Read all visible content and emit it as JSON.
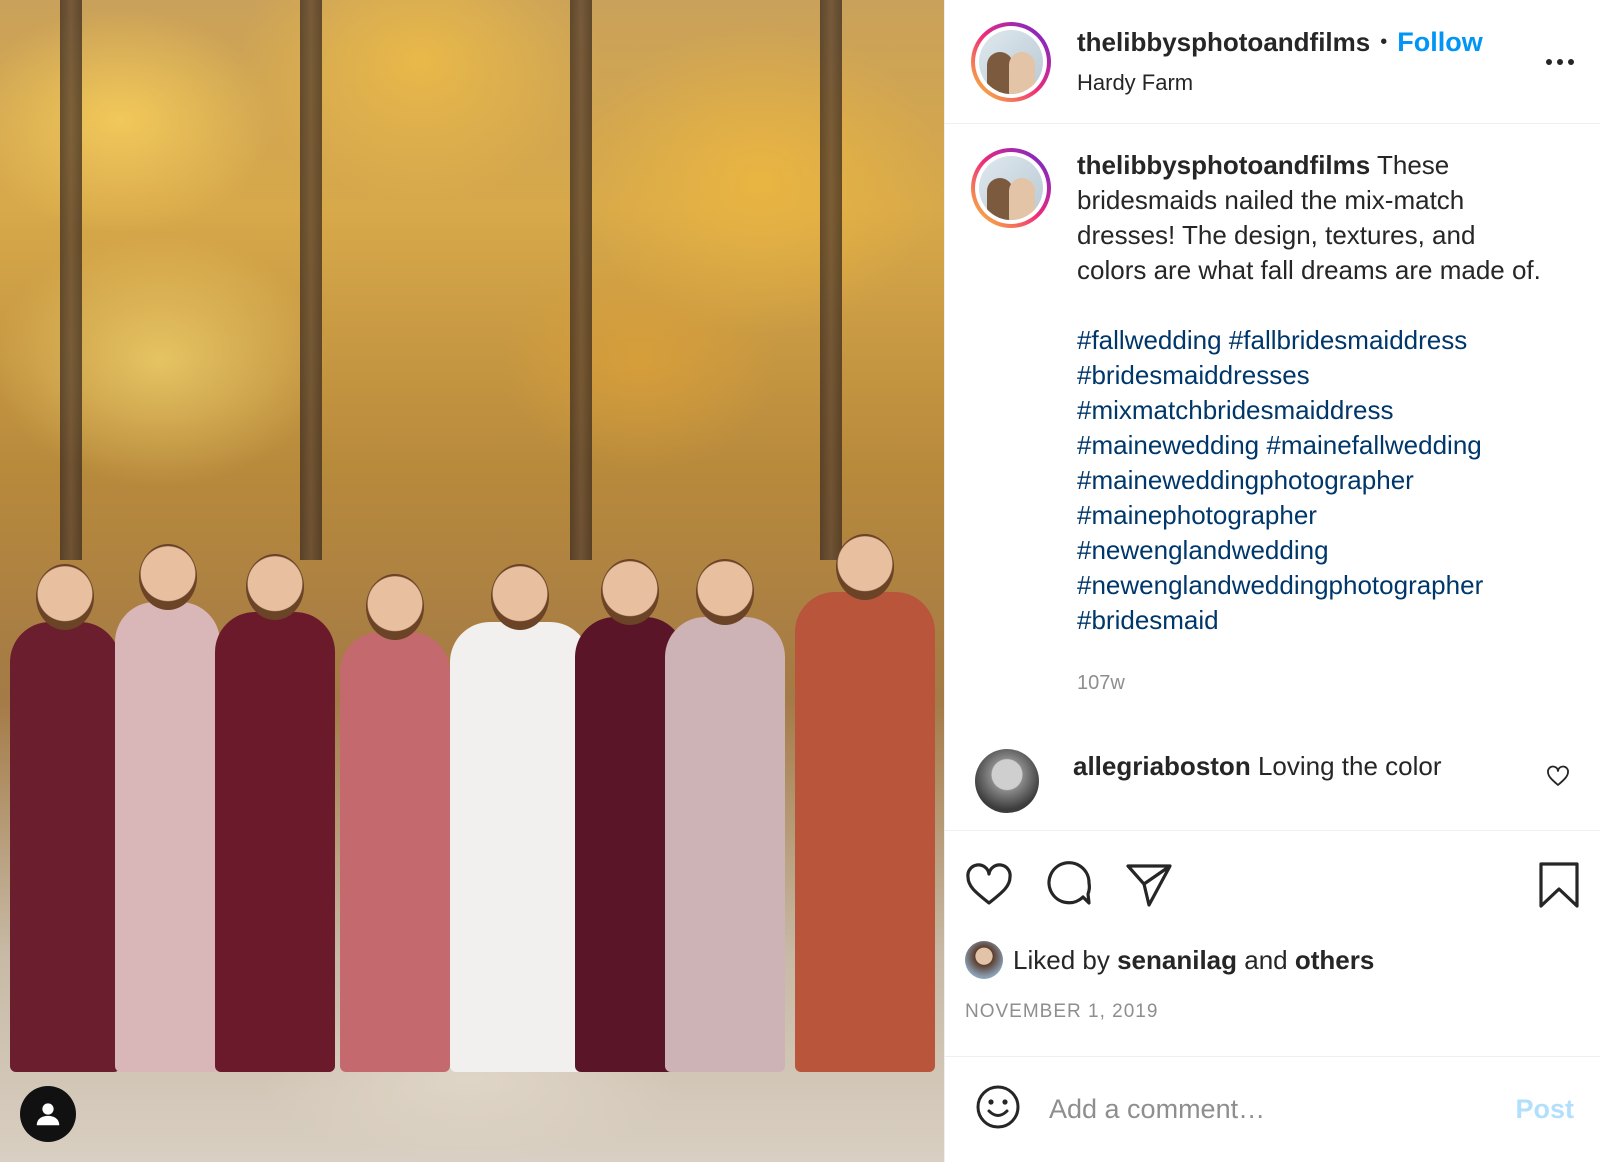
{
  "post": {
    "image": {
      "alt_icon": "person-circle-icon"
    },
    "header": {
      "username": "thelibbysphotoandfilms",
      "separator": "•",
      "follow_label": "Follow",
      "location": "Hardy Farm",
      "more_icon": "more-dots-icon"
    },
    "caption": {
      "username": "thelibbysphotoandfilms",
      "text": "These bridesmaids nailed the mix-match dresses! The design, textures, and colors are what fall dreams are made of.",
      "hashtags": [
        "#fallwedding",
        "#fallbridesmaiddress",
        "#bridesmaiddresses",
        "#mixmatchbridesmaiddress",
        "#mainewedding",
        "#mainefallwedding",
        "#maineweddingphotographer",
        "#mainephotographer",
        "#newenglandwedding",
        "#newenglandweddingphotographer",
        "#bridesmaid"
      ],
      "age": "107w"
    },
    "first_comment": {
      "username": "allegriaboston",
      "text": "Loving the color"
    },
    "likes": {
      "prefix": "Liked by",
      "user": "senanilag",
      "middle": "and",
      "others": "others"
    },
    "date": "November 1, 2019",
    "add_comment": {
      "placeholder": "Add a comment…",
      "post_label": "Post"
    },
    "colors": {
      "accent": "#0095f6",
      "hashtag": "#00376b",
      "muted": "#8e8e8e",
      "post_disabled": "#b2dffc"
    }
  }
}
